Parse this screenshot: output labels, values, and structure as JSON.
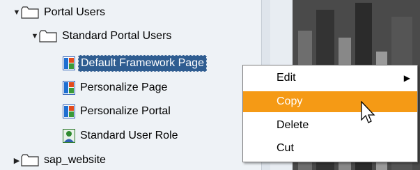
{
  "tree": {
    "items": [
      {
        "label": "Portal Users"
      },
      {
        "label": "Standard Portal Users"
      },
      {
        "label": "Default Framework Page"
      },
      {
        "label": "Personalize Page"
      },
      {
        "label": "Personalize Portal"
      },
      {
        "label": "Standard User Role"
      },
      {
        "label": "sap_website"
      }
    ]
  },
  "context_menu": {
    "items": [
      {
        "label": "Edit"
      },
      {
        "label": "Copy"
      },
      {
        "label": "Delete"
      },
      {
        "label": "Cut"
      }
    ]
  },
  "colors": {
    "selection": "#2f5d91",
    "menu_hover": "#f59a15"
  }
}
